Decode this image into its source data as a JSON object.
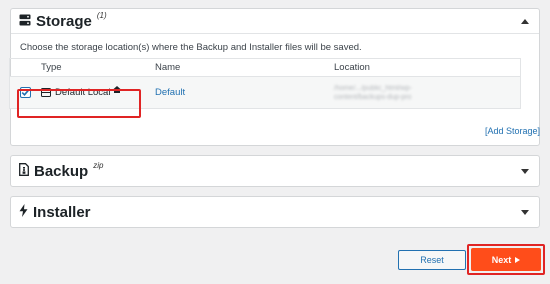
{
  "storage": {
    "title": "Storage",
    "count": "(1)",
    "description": "Choose the storage location(s) where the Backup and Installer files will be saved.",
    "columns": [
      "Type",
      "Name",
      "Location"
    ],
    "row": {
      "type": "Default Local",
      "name": "Default",
      "location": "/home/.../public_html/wp-content/backups-dup-pro",
      "checked": true
    },
    "add_storage": "[Add Storage]"
  },
  "backup": {
    "title": "Backup",
    "sup": "zip"
  },
  "installer": {
    "title": "Installer"
  },
  "buttons": {
    "reset": "Reset",
    "next": "Next"
  },
  "colors": {
    "accent": "#2271b1",
    "next": "#ff4d1a",
    "highlight": "#e02424"
  }
}
